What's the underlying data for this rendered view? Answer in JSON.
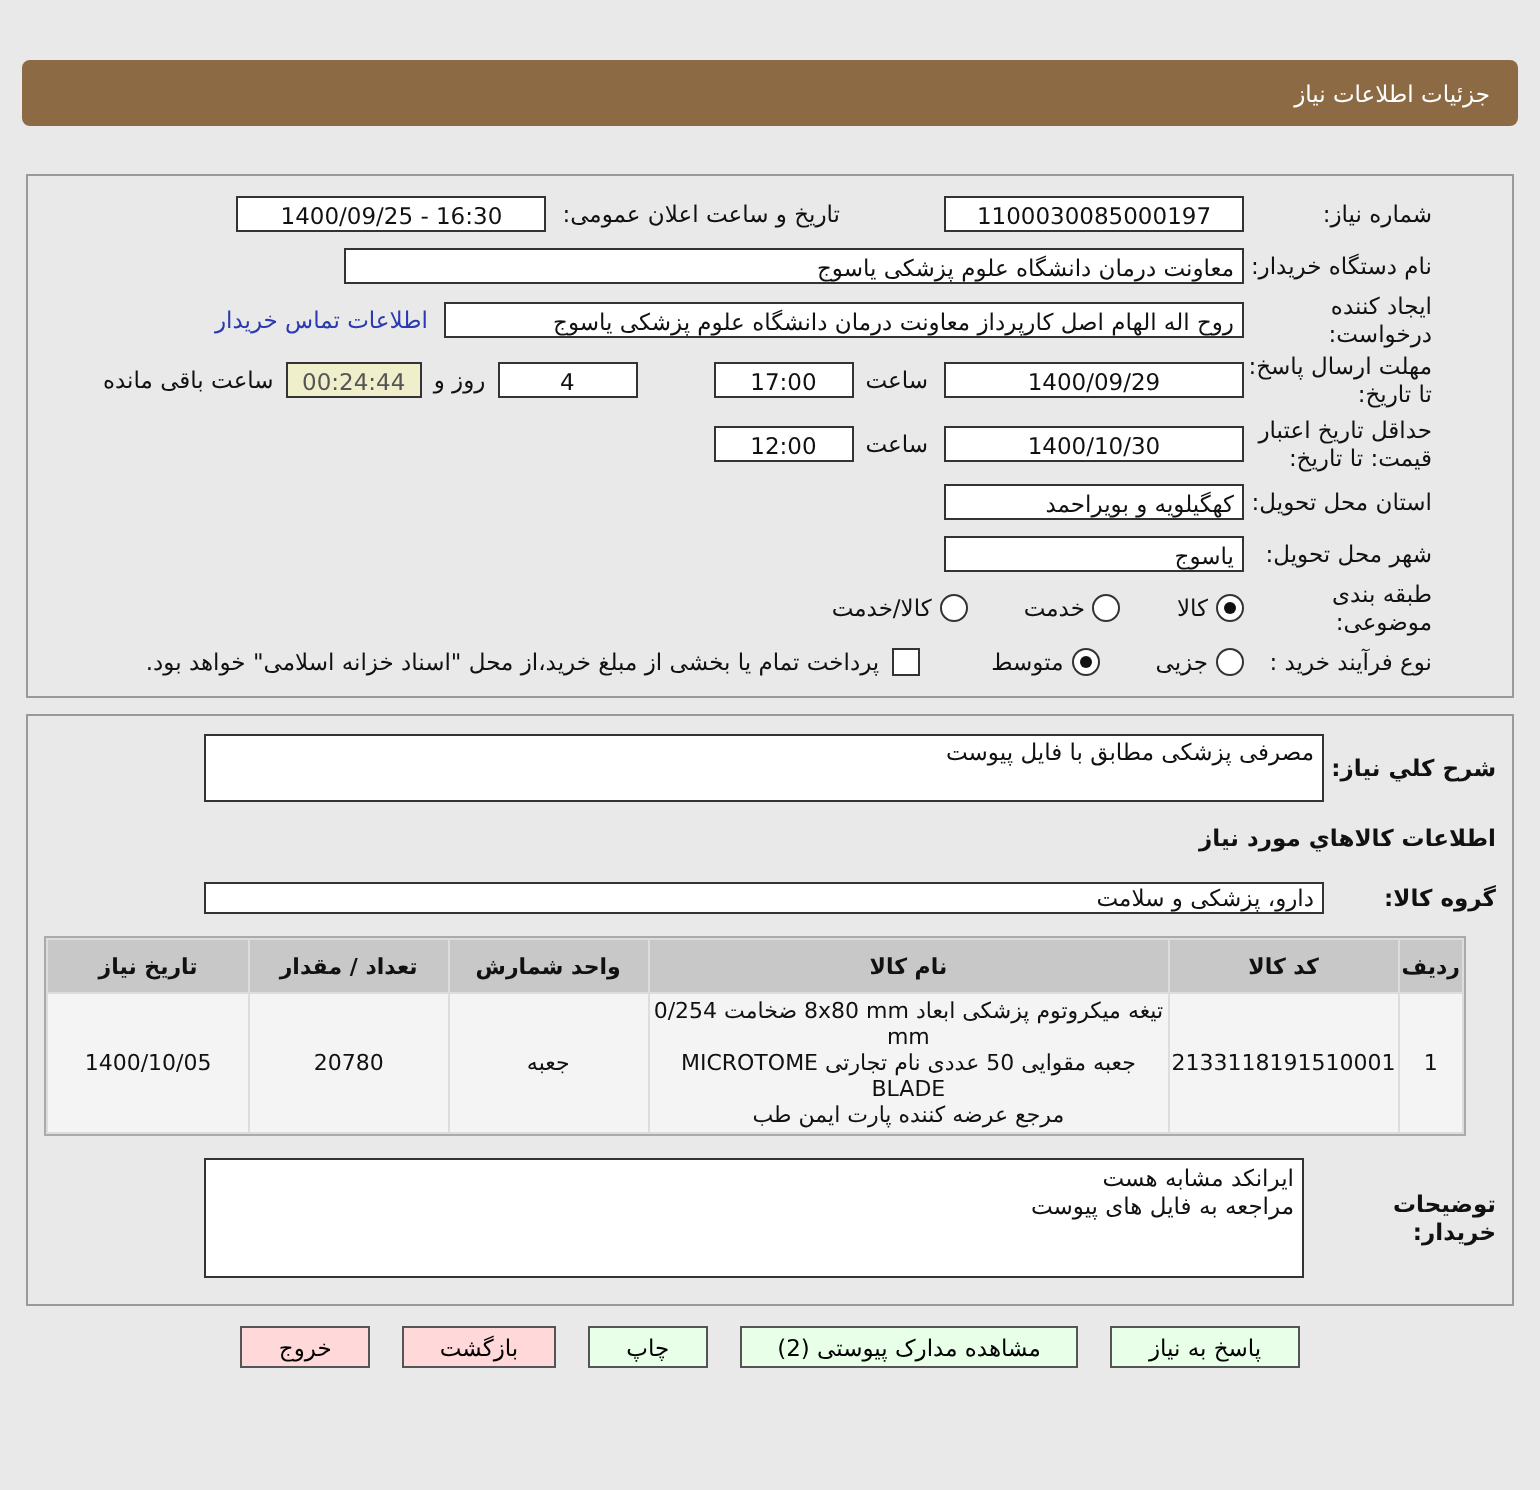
{
  "header": {
    "title": "جزئیات اطلاعات نیاز"
  },
  "need_number": {
    "label": "شماره نیاز:",
    "value": "1100030085000197"
  },
  "announce": {
    "label": "تاریخ و ساعت اعلان عمومی:",
    "value": "1400/09/25 - 16:30"
  },
  "buyer_org": {
    "label": "نام دستگاه خریدار:",
    "value": "معاونت درمان دانشگاه علوم پزشکی یاسوج"
  },
  "requester": {
    "label": "ایجاد کننده درخواست:",
    "value": "روح اله الهام اصل کارپرداز معاونت درمان دانشگاه علوم پزشکی یاسوج",
    "link": "اطلاعات تماس خریدار"
  },
  "deadline": {
    "label": "مهلت ارسال پاسخ: تا تاریخ:",
    "date": "1400/09/29",
    "time_label": "ساعت",
    "time": "17:00",
    "days": "4",
    "days_label": "روز و",
    "remaining": "00:24:44",
    "remaining_label": "ساعت باقی مانده"
  },
  "validity": {
    "label": "حداقل تاریخ اعتبار قیمت: تا تاریخ:",
    "date": "1400/10/30",
    "time_label": "ساعت",
    "time": "12:00"
  },
  "province": {
    "label": "استان محل تحویل:",
    "value": "کهگیلویه و بویراحمد"
  },
  "city": {
    "label": "شهر محل تحویل:",
    "value": "یاسوج"
  },
  "category": {
    "label": "طبقه بندی موضوعی:",
    "options": [
      {
        "label": "کالا",
        "selected": true
      },
      {
        "label": "خدمت",
        "selected": false
      },
      {
        "label": "کالا/خدمت",
        "selected": false
      }
    ]
  },
  "process": {
    "label": "نوع فرآیند خرید :",
    "options": [
      {
        "label": "جزیی",
        "selected": false
      },
      {
        "label": "متوسط",
        "selected": true
      }
    ],
    "payment": {
      "label": "پرداخت تمام یا بخشی از مبلغ خرید،از محل \"اسناد خزانه اسلامی\" خواهد بود.",
      "checked": false
    }
  },
  "description": {
    "label": "شرح کلي نياز:",
    "value": "مصرفی پزشکی مطابق با فایل پیوست"
  },
  "goods_title": "اطلاعات کالاهاي مورد نياز",
  "group": {
    "label": "گروه کالا:",
    "value": "دارو، پزشکی و سلامت"
  },
  "table": {
    "columns": [
      "ردیف",
      "کد کالا",
      "نام کالا",
      "واحد شمارش",
      "تعداد / مقدار",
      "تاریخ نیاز"
    ],
    "rows": [
      {
        "cells": [
          "1",
          "2133118191510001",
          "",
          "جعبه",
          "20780",
          "1400/10/05"
        ],
        "name_lines": [
          "تیغه میکروتوم پزشکی ابعاد 8x80 mm ضخامت 0/254 mm",
          "جعبه مقوایی 50 عددی نام تجارتی MICROTOME BLADE",
          "مرجع عرضه کننده پارت ایمن طب"
        ]
      }
    ]
  },
  "buyer_notes": {
    "label": "توضیحات خریدار:",
    "lines": [
      "ایرانکد مشابه هست",
      "مراجعه به فایل های پیوست"
    ]
  },
  "buttons": [
    {
      "label": "پاسخ به نیاز",
      "kind": "green"
    },
    {
      "label": "مشاهده مدارک پیوستی (2)",
      "kind": "green"
    },
    {
      "label": "چاپ",
      "kind": "green"
    },
    {
      "label": "بازگشت",
      "kind": "red"
    },
    {
      "label": "خروج",
      "kind": "red"
    }
  ]
}
